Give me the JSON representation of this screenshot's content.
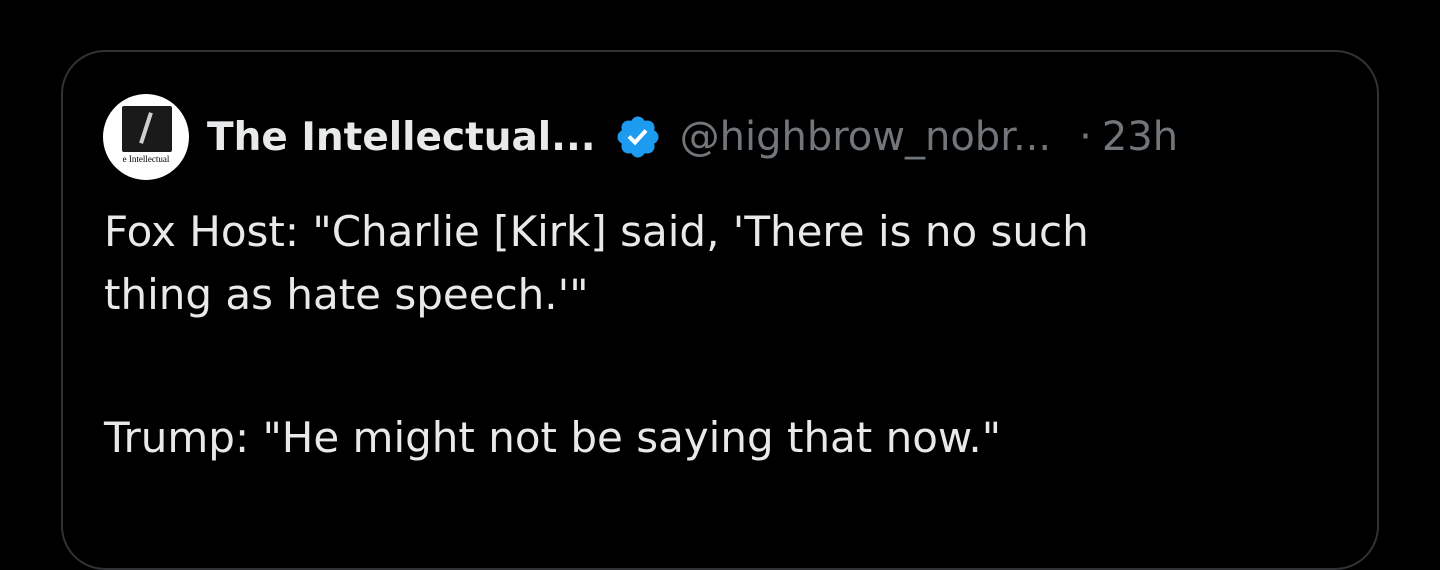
{
  "tweet": {
    "author": {
      "display_name": "The Intellectual...",
      "handle": "@highbrow_nobr...",
      "avatar_caption": "e Intellectual"
    },
    "separator": "·",
    "timestamp": "23h",
    "text_lines": [
      "Fox Host: \"Charlie [Kirk] said, 'There is no such",
      "thing as hate speech.'\"",
      "Trump: \"He might not be saying that now.\""
    ]
  },
  "icons": {
    "verified": "verified-badge-icon"
  },
  "colors": {
    "background": "#000000",
    "primary_text": "#e7e9ea",
    "secondary_text": "#71767b",
    "border": "#2f3336",
    "verified_blue": "#1d9bf0"
  }
}
